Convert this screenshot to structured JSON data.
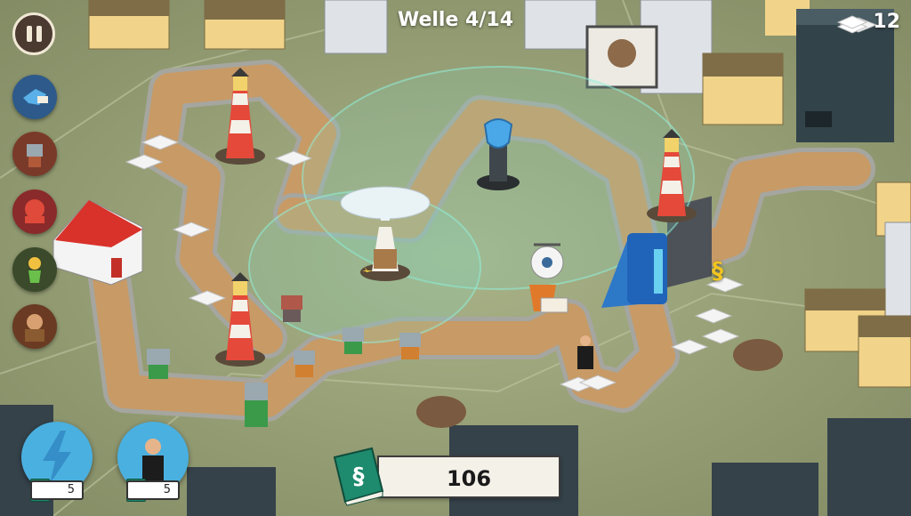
{
  "hud": {
    "wave_label": "Welle 4/14",
    "gem_count": "12",
    "money": "106",
    "money_symbol": "§"
  },
  "sidebar": {
    "enemies": [
      {
        "name": "bird-enemy-icon"
      },
      {
        "name": "robot-enemy-icon"
      },
      {
        "name": "octopus-enemy-icon"
      },
      {
        "name": "fairy-enemy-icon"
      },
      {
        "name": "brute-enemy-icon"
      }
    ]
  },
  "powers": [
    {
      "name": "lightning-power",
      "icon": "lightning-icon",
      "cost": "5",
      "cost_symbol": "§"
    },
    {
      "name": "agent-power",
      "icon": "agent-icon",
      "cost": "5",
      "cost_symbol": "§"
    }
  ],
  "map": {
    "paragraph_pickup": "§"
  },
  "colors": {
    "grass": "#9aa27a",
    "path": "#c79a66",
    "tower_red": "#d6382c",
    "book_green": "#1e8a6e",
    "power_blue": "#4ab0e0"
  }
}
